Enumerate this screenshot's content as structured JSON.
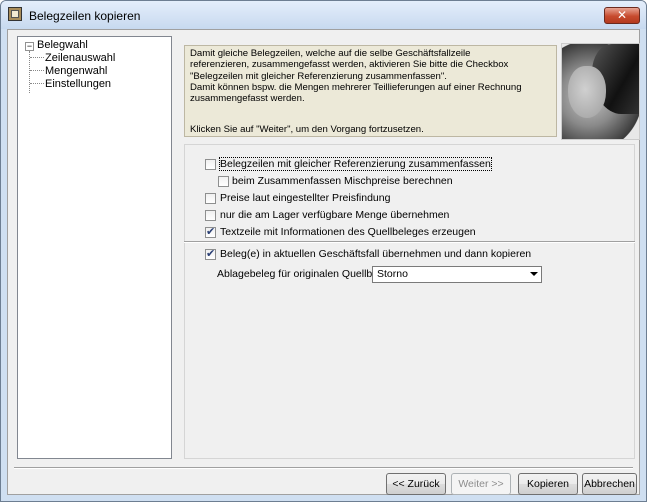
{
  "window": {
    "title": "Belegzeilen kopieren",
    "close_glyph": "✕"
  },
  "tree": {
    "root_expander": "−",
    "root_label": "Belegwahl",
    "children": [
      "Zeilenauswahl",
      "Mengenwahl",
      "Einstellungen"
    ]
  },
  "info": {
    "lines": [
      "Damit gleiche Belegzeilen, welche auf die selbe Geschäftsfallzeile",
      "referenzieren, zusammengefasst werden, aktivieren Sie bitte die Checkbox",
      "\"Belegzeilen mit gleicher Referenzierung zusammenfassen\".",
      "Damit können bspw. die Mengen mehrerer Teillieferungen auf einer Rechnung",
      "zusammengefasst werden."
    ],
    "hint": "Klicken Sie auf \"Weiter\", um den Vorgang fortzusetzen."
  },
  "options": [
    {
      "label": "Belegzeilen mit gleicher Referenzierung zusammenfassen",
      "checked": false
    },
    {
      "label": "beim Zusammenfassen Mischpreise berechnen",
      "checked": false
    },
    {
      "label": "Preise laut eingestellter Preisfindung",
      "checked": false
    },
    {
      "label": "nur die am Lager verfügbare Menge übernehmen",
      "checked": false
    },
    {
      "label": "Textzeile mit Informationen des Quellbeleges erzeugen",
      "checked": true
    },
    {
      "label": "Beleg(e) in aktuellen Geschäftsfall übernehmen und dann kopieren",
      "checked": true
    }
  ],
  "ablage": {
    "label": "Ablagebeleg für originalen Quellbeleg",
    "selected": "Storno"
  },
  "buttons": {
    "back": "<< Zurück",
    "next": "Weiter >>",
    "copy": "Kopieren",
    "cancel": "Abbrechen"
  }
}
